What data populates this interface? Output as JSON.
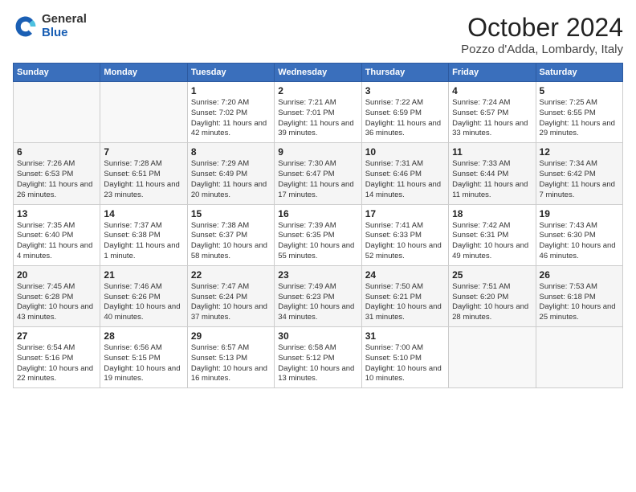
{
  "header": {
    "logo_general": "General",
    "logo_blue": "Blue",
    "month": "October 2024",
    "location": "Pozzo d'Adda, Lombardy, Italy"
  },
  "weekdays": [
    "Sunday",
    "Monday",
    "Tuesday",
    "Wednesday",
    "Thursday",
    "Friday",
    "Saturday"
  ],
  "weeks": [
    [
      {
        "day": "",
        "info": ""
      },
      {
        "day": "",
        "info": ""
      },
      {
        "day": "1",
        "info": "Sunrise: 7:20 AM\nSunset: 7:02 PM\nDaylight: 11 hours and 42 minutes."
      },
      {
        "day": "2",
        "info": "Sunrise: 7:21 AM\nSunset: 7:01 PM\nDaylight: 11 hours and 39 minutes."
      },
      {
        "day": "3",
        "info": "Sunrise: 7:22 AM\nSunset: 6:59 PM\nDaylight: 11 hours and 36 minutes."
      },
      {
        "day": "4",
        "info": "Sunrise: 7:24 AM\nSunset: 6:57 PM\nDaylight: 11 hours and 33 minutes."
      },
      {
        "day": "5",
        "info": "Sunrise: 7:25 AM\nSunset: 6:55 PM\nDaylight: 11 hours and 29 minutes."
      }
    ],
    [
      {
        "day": "6",
        "info": "Sunrise: 7:26 AM\nSunset: 6:53 PM\nDaylight: 11 hours and 26 minutes."
      },
      {
        "day": "7",
        "info": "Sunrise: 7:28 AM\nSunset: 6:51 PM\nDaylight: 11 hours and 23 minutes."
      },
      {
        "day": "8",
        "info": "Sunrise: 7:29 AM\nSunset: 6:49 PM\nDaylight: 11 hours and 20 minutes."
      },
      {
        "day": "9",
        "info": "Sunrise: 7:30 AM\nSunset: 6:47 PM\nDaylight: 11 hours and 17 minutes."
      },
      {
        "day": "10",
        "info": "Sunrise: 7:31 AM\nSunset: 6:46 PM\nDaylight: 11 hours and 14 minutes."
      },
      {
        "day": "11",
        "info": "Sunrise: 7:33 AM\nSunset: 6:44 PM\nDaylight: 11 hours and 11 minutes."
      },
      {
        "day": "12",
        "info": "Sunrise: 7:34 AM\nSunset: 6:42 PM\nDaylight: 11 hours and 7 minutes."
      }
    ],
    [
      {
        "day": "13",
        "info": "Sunrise: 7:35 AM\nSunset: 6:40 PM\nDaylight: 11 hours and 4 minutes."
      },
      {
        "day": "14",
        "info": "Sunrise: 7:37 AM\nSunset: 6:38 PM\nDaylight: 11 hours and 1 minute."
      },
      {
        "day": "15",
        "info": "Sunrise: 7:38 AM\nSunset: 6:37 PM\nDaylight: 10 hours and 58 minutes."
      },
      {
        "day": "16",
        "info": "Sunrise: 7:39 AM\nSunset: 6:35 PM\nDaylight: 10 hours and 55 minutes."
      },
      {
        "day": "17",
        "info": "Sunrise: 7:41 AM\nSunset: 6:33 PM\nDaylight: 10 hours and 52 minutes."
      },
      {
        "day": "18",
        "info": "Sunrise: 7:42 AM\nSunset: 6:31 PM\nDaylight: 10 hours and 49 minutes."
      },
      {
        "day": "19",
        "info": "Sunrise: 7:43 AM\nSunset: 6:30 PM\nDaylight: 10 hours and 46 minutes."
      }
    ],
    [
      {
        "day": "20",
        "info": "Sunrise: 7:45 AM\nSunset: 6:28 PM\nDaylight: 10 hours and 43 minutes."
      },
      {
        "day": "21",
        "info": "Sunrise: 7:46 AM\nSunset: 6:26 PM\nDaylight: 10 hours and 40 minutes."
      },
      {
        "day": "22",
        "info": "Sunrise: 7:47 AM\nSunset: 6:24 PM\nDaylight: 10 hours and 37 minutes."
      },
      {
        "day": "23",
        "info": "Sunrise: 7:49 AM\nSunset: 6:23 PM\nDaylight: 10 hours and 34 minutes."
      },
      {
        "day": "24",
        "info": "Sunrise: 7:50 AM\nSunset: 6:21 PM\nDaylight: 10 hours and 31 minutes."
      },
      {
        "day": "25",
        "info": "Sunrise: 7:51 AM\nSunset: 6:20 PM\nDaylight: 10 hours and 28 minutes."
      },
      {
        "day": "26",
        "info": "Sunrise: 7:53 AM\nSunset: 6:18 PM\nDaylight: 10 hours and 25 minutes."
      }
    ],
    [
      {
        "day": "27",
        "info": "Sunrise: 6:54 AM\nSunset: 5:16 PM\nDaylight: 10 hours and 22 minutes."
      },
      {
        "day": "28",
        "info": "Sunrise: 6:56 AM\nSunset: 5:15 PM\nDaylight: 10 hours and 19 minutes."
      },
      {
        "day": "29",
        "info": "Sunrise: 6:57 AM\nSunset: 5:13 PM\nDaylight: 10 hours and 16 minutes."
      },
      {
        "day": "30",
        "info": "Sunrise: 6:58 AM\nSunset: 5:12 PM\nDaylight: 10 hours and 13 minutes."
      },
      {
        "day": "31",
        "info": "Sunrise: 7:00 AM\nSunset: 5:10 PM\nDaylight: 10 hours and 10 minutes."
      },
      {
        "day": "",
        "info": ""
      },
      {
        "day": "",
        "info": ""
      }
    ]
  ]
}
